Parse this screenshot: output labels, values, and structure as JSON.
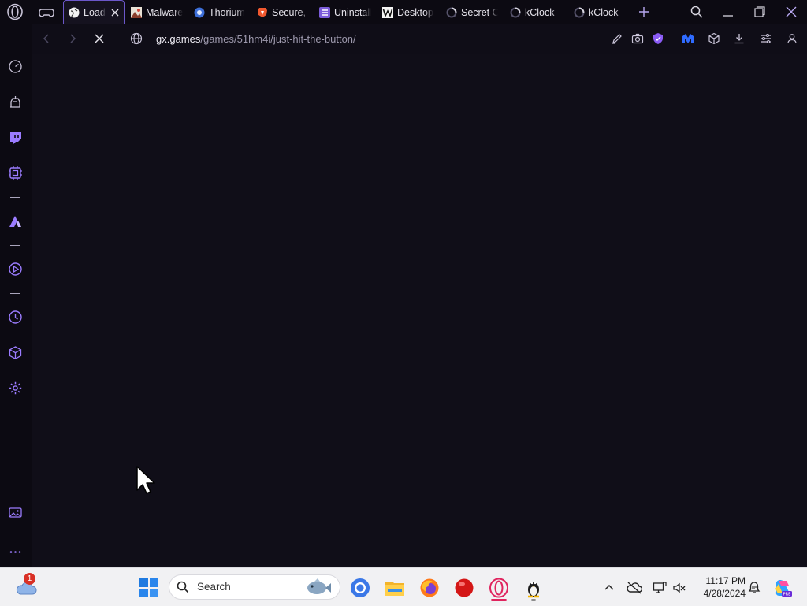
{
  "tabs": [
    {
      "label": "Load",
      "icon": "globe-icon",
      "active": true
    },
    {
      "label": "Malware",
      "icon": "malware-favicon"
    },
    {
      "label": "Thorium",
      "icon": "thorium-favicon"
    },
    {
      "label": "Secure, P",
      "icon": "brave-favicon"
    },
    {
      "label": "Uninstall",
      "icon": "uninstall-favicon"
    },
    {
      "label": "Desktop",
      "icon": "w-favicon"
    },
    {
      "label": "Secret C",
      "icon": "loading-spinner-icon"
    },
    {
      "label": "kClock -",
      "icon": "loading-spinner-icon"
    },
    {
      "label": "kClock -",
      "icon": "loading-spinner-icon"
    }
  ],
  "address": {
    "host": "gx.games",
    "path": "/games/51hm4i/just-hit-the-button/"
  },
  "taskbar": {
    "search_placeholder": "Search",
    "weather_badge": "1",
    "time": "11:17 PM",
    "date": "4/28/2024"
  },
  "colors": {
    "accent": "#8b5cf6",
    "background": "#100e18"
  }
}
